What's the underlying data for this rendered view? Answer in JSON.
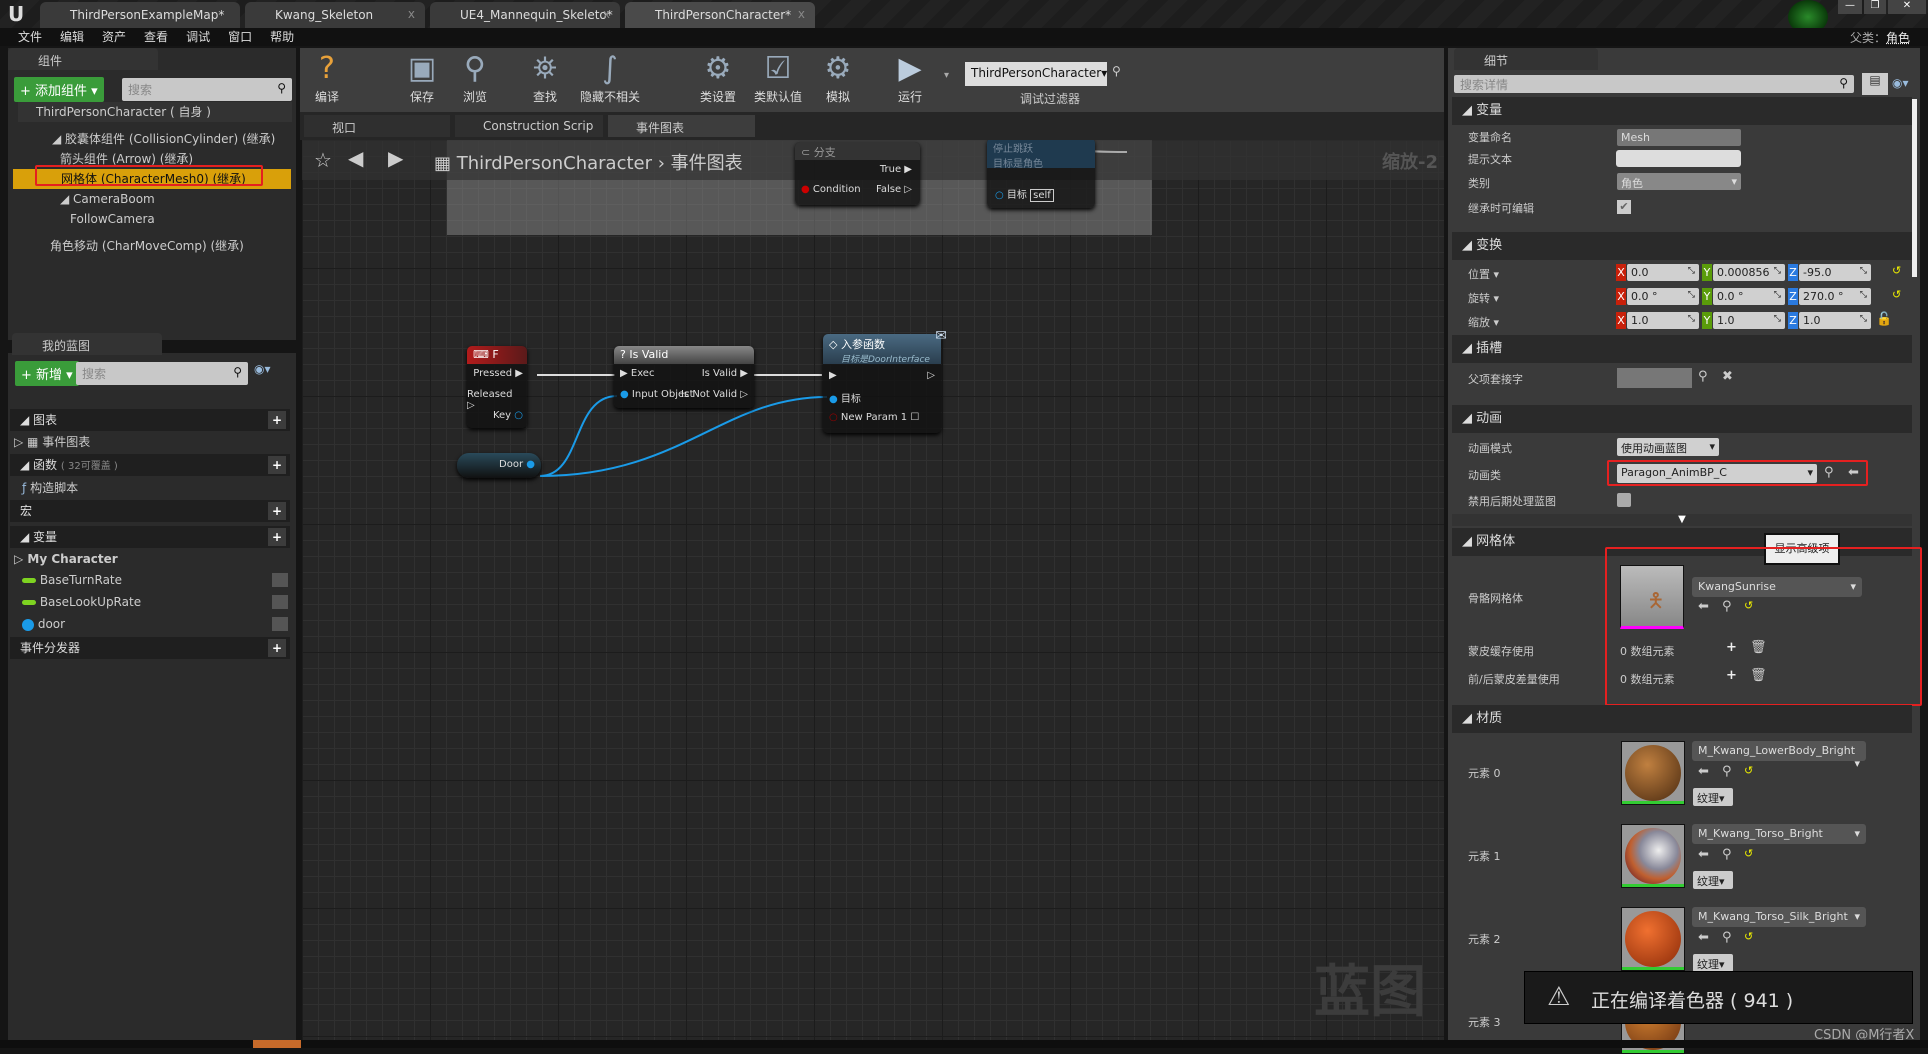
{
  "window": {
    "doc_tabs": [
      {
        "label": "ThirdPersonExampleMap*"
      },
      {
        "label": "Kwang_Skeleton"
      },
      {
        "label": "UE4_Mannequin_Skeleto*"
      },
      {
        "label": "ThirdPersonCharacter*"
      }
    ],
    "parent_class_label": "父类：",
    "parent_class_value": "角色"
  },
  "menu": [
    "文件",
    "编辑",
    "资产",
    "查看",
    "调试",
    "窗口",
    "帮助"
  ],
  "components": {
    "tab": "组件",
    "add_button": "添加组件",
    "search_placeholder": "搜索",
    "items": [
      "ThirdPersonCharacter ( 自身 )",
      "胶囊体组件 (CollisionCylinder) (继承)",
      "箭头组件 (Arrow) (继承)",
      "网格体 (CharacterMesh0) (继承)",
      "CameraBoom",
      "FollowCamera",
      "角色移动 (CharMoveComp) (继承)"
    ]
  },
  "my_blueprint": {
    "tab": "我的蓝图",
    "new_button": "新增",
    "search_placeholder": "搜索",
    "graphs": "图表",
    "event_graph": "事件图表",
    "functions": "函数",
    "functions_note": "( 32可覆盖 )",
    "construction": "构造脚本",
    "macros": "宏",
    "variables": "变量",
    "category": "My Character",
    "vars": [
      {
        "name": "BaseTurnRate",
        "color": "#7ed321"
      },
      {
        "name": "BaseLookUpRate",
        "color": "#7ed321"
      },
      {
        "name": "door",
        "color": "#1a9be8"
      }
    ],
    "dispatchers": "事件分发器"
  },
  "toolbar": {
    "buttons": [
      "编译",
      "保存",
      "浏览",
      "查找",
      "隐藏不相关",
      "类设置",
      "类默认值",
      "模拟",
      "运行"
    ],
    "debug_filter_value": "ThirdPersonCharacter",
    "debug_filter_label": "调试过滤器"
  },
  "graph_tabs": [
    "视口",
    "Construction Scrip",
    "事件图表"
  ],
  "graph": {
    "breadcrumb_root": "ThirdPersonCharacter",
    "breadcrumb_current": "事件图表",
    "zoom": "缩放-2",
    "watermark": "蓝图",
    "branch": {
      "title": "分支",
      "true": "True",
      "condition": "Condition",
      "false": "False"
    },
    "stop_jump": {
      "title": "停止跳跃",
      "subtitle": "目标是角色",
      "target": "目标",
      "self": "self"
    },
    "key_f": {
      "title": "F",
      "pressed": "Pressed",
      "released": "Released",
      "key": "Key"
    },
    "is_valid": {
      "title": "Is Valid",
      "exec": "Exec",
      "is_valid": "Is Valid",
      "input": "Input Object",
      "not_valid": "Is Not Valid"
    },
    "iface": {
      "title": "入参函数",
      "subtitle": "目标是DoorInterface",
      "target": "目标",
      "param": "New Param 1"
    },
    "door": "Door"
  },
  "details": {
    "tab": "细节",
    "search_placeholder": "搜索详情",
    "variable": {
      "header": "变量",
      "name_label": "变量命名",
      "name_value": "Mesh",
      "tooltip_label": "提示文本",
      "category_label": "类别",
      "category_value": "角色",
      "editable_label": "继承时可编辑"
    },
    "transform": {
      "header": "变换",
      "rows": [
        {
          "label": "位置",
          "x": "0.0",
          "y": "0.000856",
          "z": "-95.0"
        },
        {
          "label": "旋转",
          "x": "0.0 °",
          "y": "0.0 °",
          "z": "270.0 °"
        },
        {
          "label": "缩放",
          "x": "1.0",
          "y": "1.0",
          "z": "1.0"
        }
      ]
    },
    "sockets": {
      "header": "插槽",
      "parent_socket": "父项套接字"
    },
    "animation": {
      "header": "动画",
      "mode_label": "动画模式",
      "mode_value": "使用动画蓝图",
      "class_label": "动画类",
      "class_value": "Paragon_AnimBP_C",
      "disable_label": "禁用后期处理蓝图"
    },
    "mesh": {
      "header": "网格体",
      "tooltip": "显示高级项",
      "skeletal_label": "骨骼网格体",
      "skeletal_value": "KwangSunrise",
      "skin_cache_label": "蒙皮缓存使用",
      "skin_cache_value": "0 数组元素",
      "delta_label": "前/后蒙皮差量使用",
      "delta_value": "0 数组元素"
    },
    "materials": {
      "header": "材质",
      "texture_btn": "纹理",
      "elements": [
        {
          "label": "元素 0",
          "value": "M_Kwang_LowerBody_Bright"
        },
        {
          "label": "元素 1",
          "value": "M_Kwang_Torso_Bright"
        },
        {
          "label": "元素 2",
          "value": "M_Kwang_Torso_Silk_Bright"
        },
        {
          "label": "元素 3",
          "value": ""
        }
      ]
    }
  },
  "toast": {
    "text": "正在编译着色器 ( 941 )"
  },
  "watermark": "CSDN @M行者X"
}
